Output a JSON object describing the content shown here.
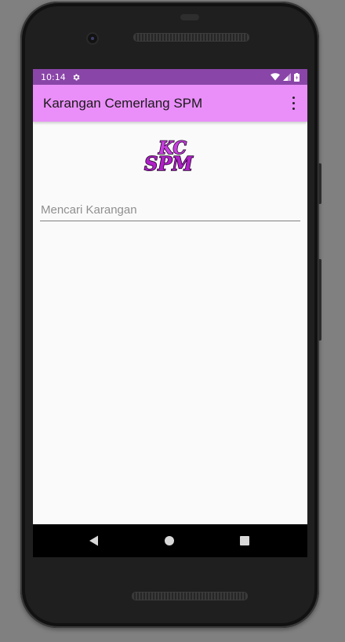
{
  "status_bar": {
    "time": "10:14",
    "icons": [
      "gear-icon",
      "wifi-icon",
      "signal-icon",
      "battery-icon"
    ]
  },
  "app_bar": {
    "title": "Karangan Cemerlang SPM",
    "menu_icon": "overflow-menu-icon"
  },
  "logo": {
    "text_line1": "KC",
    "text_line2": "SPM"
  },
  "search": {
    "placeholder": "Mencari Karangan",
    "value": ""
  },
  "nav_bar": {
    "icons": [
      "back-icon",
      "home-icon",
      "recents-icon"
    ]
  },
  "colors": {
    "status_bar": "#8a45a8",
    "app_bar": "#ea8ff9",
    "logo_purple": "#b020c8"
  }
}
